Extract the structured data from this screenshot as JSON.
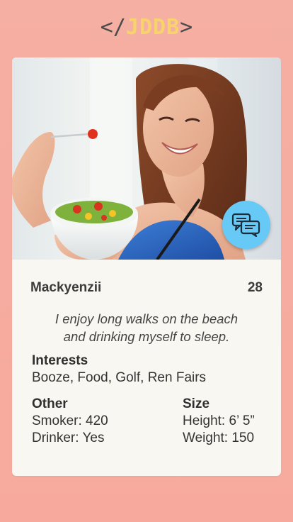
{
  "logo": {
    "open": "</",
    "brand": "JDDB",
    "close": ">"
  },
  "profile": {
    "name": "Mackyenzii",
    "age": "28",
    "bio_line1": "I enjoy long walks on the beach",
    "bio_line2": "and drinking myself to sleep.",
    "interests_title": "Interests",
    "interests": "Booze, Food, Golf, Ren Fairs",
    "other_title": "Other",
    "smoker": "Smoker: 420",
    "drinker": "Drinker: Yes",
    "size_title": "Size",
    "height": "Height: 6’ 5”",
    "weight": "Weight: 150"
  },
  "icons": {
    "chat": "chat-bubbles-icon"
  },
  "colors": {
    "background": "#f6afa3",
    "brand_yellow": "#f6d36b",
    "chat_blue": "#67c9f5",
    "card": "#f8f7f2"
  }
}
